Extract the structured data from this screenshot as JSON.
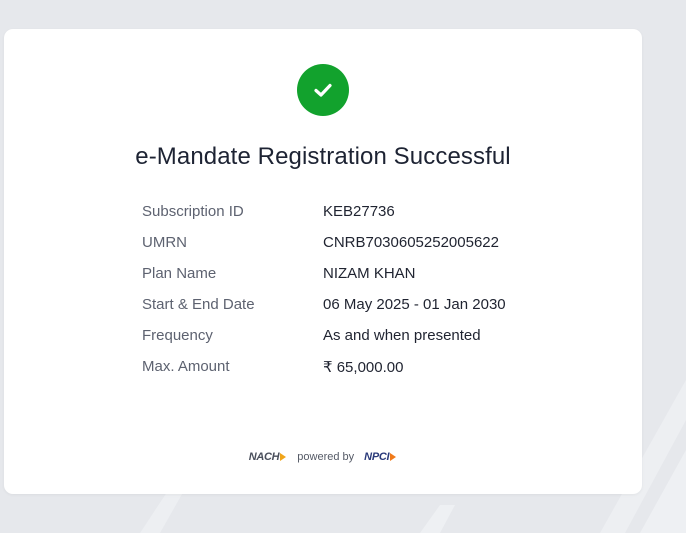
{
  "title": "e-Mandate Registration Successful",
  "details": [
    {
      "label": "Subscription ID",
      "value": "KEB27736"
    },
    {
      "label": "UMRN",
      "value": "CNRB7030605252005622"
    },
    {
      "label": "Plan Name",
      "value": "NIZAM KHAN"
    },
    {
      "label": "Start & End Date",
      "value": "06 May 2025 - 01 Jan 2030"
    },
    {
      "label": "Frequency",
      "value": "As and when presented"
    },
    {
      "label": "Max. Amount",
      "value": "₹ 65,000.00"
    }
  ],
  "footer": {
    "nach_logo": "NACH",
    "powered_by": "powered by",
    "npci_logo": "NPCI"
  },
  "icons": {
    "success": "check-circle-icon"
  },
  "colors": {
    "success_green": "#12a22d",
    "background": "#e6e8ec",
    "card": "#ffffff"
  }
}
